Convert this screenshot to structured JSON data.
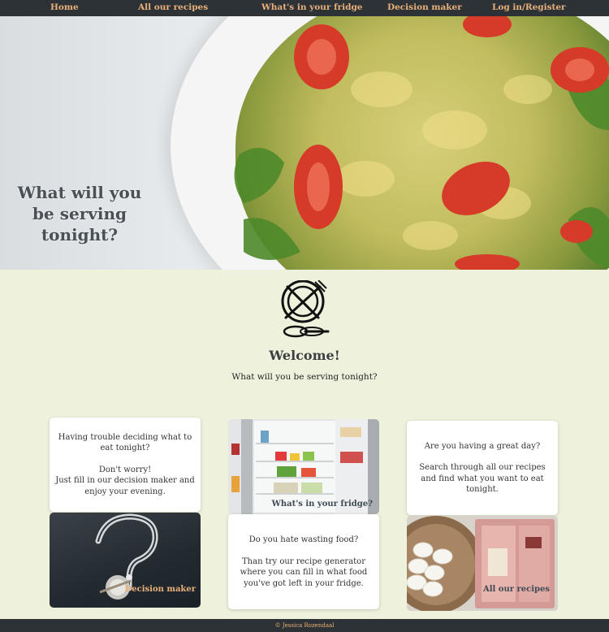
{
  "nav": {
    "home": "Home",
    "recipes": "All our recipes",
    "fridge": "What's in your fridge",
    "decision": "Decision maker",
    "login": "Log in/Register"
  },
  "hero": {
    "title": "What will you be serving tonight?"
  },
  "welcome": {
    "icon": "plate-fork-knife-spoon-icon",
    "title": "Welcome!",
    "subtitle": "What will you be serving tonight?"
  },
  "cards": {
    "decision_text": {
      "line1": "Having trouble deciding what to eat tonight?",
      "line2": "Don't worry!",
      "line3": "Just fill in our decision maker and enjoy your evening."
    },
    "fridge_photo": {
      "caption": "What's in your fridge?"
    },
    "great_day": {
      "line1": "Are you having a great day?",
      "line2": "Search through all our recipes and find what you want to eat tonight."
    },
    "decision_photo": {
      "caption": "Decision maker"
    },
    "waste": {
      "line1": "Do you hate wasting food?",
      "line2": "Than try our recipe generator where you can fill in what food you've got left in your fridge."
    },
    "recipes_photo": {
      "caption": "All our recipes"
    }
  },
  "footer": {
    "text": "© Jessica Rozendaal"
  },
  "colors": {
    "nav_bg": "#2d3236",
    "nav_text": "#e8b07a",
    "page_bg": "#eef2dc"
  }
}
